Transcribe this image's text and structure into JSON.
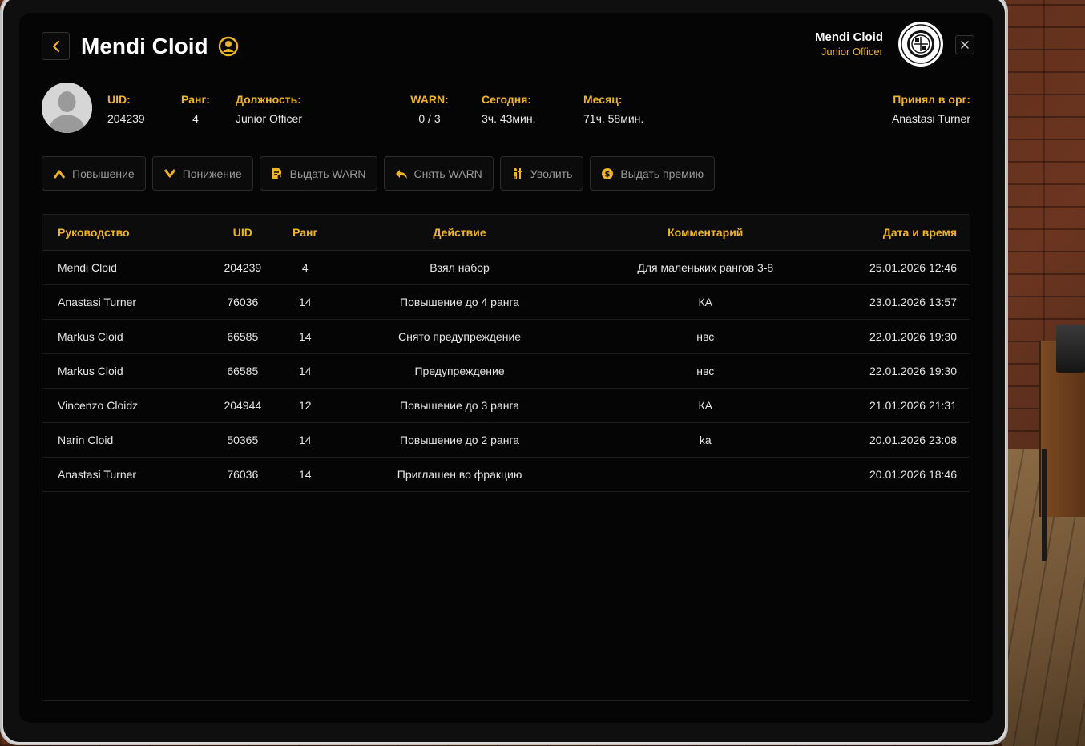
{
  "header": {
    "title": "Mendi Cloid",
    "current_user": {
      "name": "Mendi Cloid",
      "role": "Junior Officer"
    }
  },
  "profile": {
    "uid": {
      "label": "UID:",
      "value": "204239"
    },
    "rank": {
      "label": "Ранг:",
      "value": "4"
    },
    "position": {
      "label": "Должность:",
      "value": "Junior Officer"
    },
    "warn": {
      "label": "WARN:",
      "value": "0 / 3"
    },
    "today": {
      "label": "Сегодня:",
      "value": "3ч. 43мин."
    },
    "month": {
      "label": "Месяц:",
      "value": "71ч. 58мин."
    },
    "accepted_by": {
      "label": "Принял в орг:",
      "value": "Anastasi Turner"
    }
  },
  "actions": [
    {
      "label": "Повышение",
      "icon": "chevron-up-icon"
    },
    {
      "label": "Понижение",
      "icon": "chevron-down-icon"
    },
    {
      "label": "Выдать WARN",
      "icon": "warn-document-icon"
    },
    {
      "label": "Снять WARN",
      "icon": "undo-icon"
    },
    {
      "label": "Уволить",
      "icon": "fire-person-icon"
    },
    {
      "label": "Выдать премию",
      "icon": "coin-icon"
    }
  ],
  "table": {
    "columns": [
      "Руководство",
      "UID",
      "Ранг",
      "Действие",
      "Комментарий",
      "Дата и время"
    ],
    "rows": [
      [
        "Mendi Cloid",
        "204239",
        "4",
        "Взял набор",
        "Для маленьких рангов 3-8",
        "25.01.2026 12:46"
      ],
      [
        "Anastasi Turner",
        "76036",
        "14",
        "Повышение до 4 ранга",
        "КА",
        "23.01.2026 13:57"
      ],
      [
        "Markus Cloid",
        "66585",
        "14",
        "Снято предупреждение",
        "нвс",
        "22.01.2026 19:30"
      ],
      [
        "Markus Cloid",
        "66585",
        "14",
        "Предупреждение",
        "нвс",
        "22.01.2026 19:30"
      ],
      [
        "Vincenzo Cloidz",
        "204944",
        "12",
        "Повышение до 3 ранга",
        "КА",
        "21.01.2026 21:31"
      ],
      [
        "Narin Cloid",
        "50365",
        "14",
        "Повышение до 2 ранга",
        "ka",
        "20.01.2026 23:08"
      ],
      [
        "Anastasi Turner",
        "76036",
        "14",
        "Приглашен во фракцию",
        "",
        "20.01.2026 18:46"
      ]
    ]
  },
  "colors": {
    "accent": "#f0b429",
    "background": "#050505",
    "text": "#e6e6e6"
  }
}
